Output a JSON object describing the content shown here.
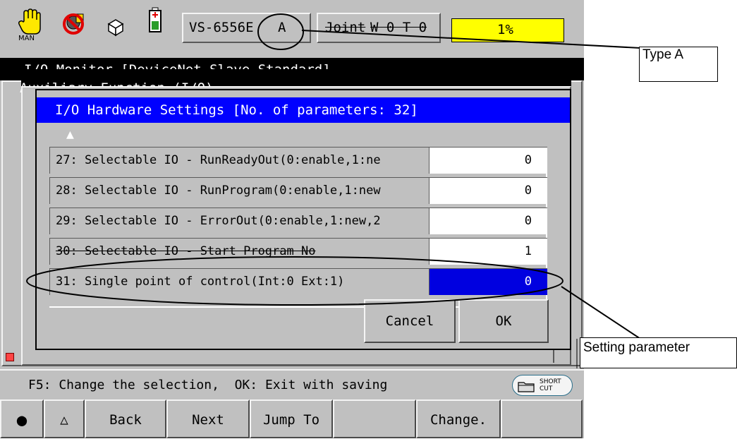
{
  "status_bar": {
    "mode_label": "MAN",
    "robot_model": "VS-6556E",
    "robot_type": "A",
    "joint_label": "Joint",
    "tool_work": "W 0 T 0",
    "speed": "1%"
  },
  "background_window": {
    "title": "I/O Monitor [DeviceNet Slave Standard]",
    "subtitle": "Auxiliary Function (I/O)"
  },
  "dialog": {
    "title": "I/O Hardware Settings [No. of parameters: 32]",
    "scroll_up_glyph": "▲",
    "rows": [
      {
        "label": "27: Selectable IO - RunReadyOut(0:enable,1:ne",
        "value": "0"
      },
      {
        "label": "28: Selectable IO - RunProgram(0:enable,1:new",
        "value": "0"
      },
      {
        "label": "29: Selectable IO - ErrorOut(0:enable,1:new,2",
        "value": "0"
      },
      {
        "label": "30: Selectable IO - Start Program No",
        "value": "1"
      },
      {
        "label": "31: Single point of control(Int:0 Ext:1)",
        "value": "0"
      }
    ],
    "cancel_label": "Cancel",
    "ok_label": "OK"
  },
  "message_bar": {
    "text": "F5: Change the selection,  OK: Exit with saving",
    "shortcut_label": "SHORT CUT"
  },
  "function_keys": [
    {
      "label": "●"
    },
    {
      "label": "△"
    },
    {
      "label": "Back"
    },
    {
      "label": "Next"
    },
    {
      "label": "Jump To"
    },
    {
      "label": ""
    },
    {
      "label": "Change."
    },
    {
      "label": ""
    }
  ],
  "callouts": {
    "type_a": "Type A",
    "setting_parameter": "Setting parameter"
  },
  "colors": {
    "title_blue": "#0000ff",
    "selected_blue": "#0000e0",
    "speed_yellow": "#ffff00",
    "panel_gray": "#c0c0c0"
  }
}
